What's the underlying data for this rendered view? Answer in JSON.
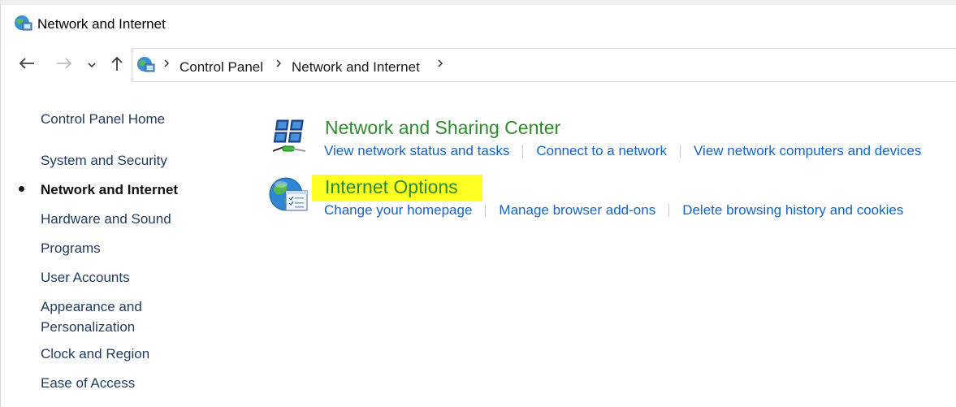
{
  "window": {
    "title": "Network and Internet"
  },
  "nav": {
    "back_icon": "back-arrow-icon",
    "forward_icon": "forward-arrow-icon",
    "recent_icon": "chevron-down-icon",
    "up_icon": "up-arrow-icon"
  },
  "address": {
    "breadcrumbs": [
      "Control Panel",
      "Network and Internet"
    ]
  },
  "sidebar": {
    "items": [
      {
        "label": "Control Panel Home"
      },
      {
        "label": "System and Security"
      },
      {
        "label": "Network and Internet",
        "current": true
      },
      {
        "label": "Hardware and Sound"
      },
      {
        "label": "Programs"
      },
      {
        "label": "User Accounts"
      },
      {
        "label": "Appearance and"
      },
      {
        "label": "Personalization"
      },
      {
        "label": "Clock and Region"
      },
      {
        "label": "Ease of Access"
      }
    ]
  },
  "categories": [
    {
      "title": "Network and Sharing Center",
      "icon": "network-sharing-icon",
      "tasks": [
        "View network status and tasks",
        "Connect to a network",
        "View network computers and devices"
      ]
    },
    {
      "title": "Internet Options",
      "icon": "internet-options-icon",
      "highlight_color": "#ffff22",
      "tasks": [
        "Change your homepage",
        "Manage browser add-ons",
        "Delete browsing history and cookies"
      ]
    }
  ],
  "colors": {
    "category_title": "#2e8b2e",
    "task_link": "#1464c8",
    "sidebar_link": "#1e3a5c",
    "highlight": "#ffff22"
  }
}
